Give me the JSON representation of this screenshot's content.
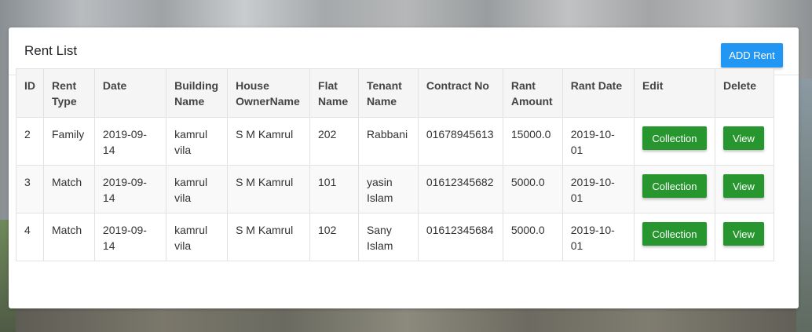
{
  "card": {
    "title": "Rent List",
    "add_button": "ADD Rent"
  },
  "table": {
    "headers": [
      "ID",
      "Rent Type",
      "Date",
      "Building Name",
      "House OwnerName",
      "Flat Name",
      "Tenant Name",
      "Contract No",
      "Rant Amount",
      "Rant Date",
      "Edit",
      "Delete"
    ],
    "rows": [
      {
        "id": "2",
        "rent_type": "Family",
        "date": "2019-09-14",
        "building": "kamrul vila",
        "owner": "S M Kamrul",
        "flat": "202",
        "tenant": "Rabbani",
        "contract": "01678945613",
        "amount": "15000.0",
        "rant_date": "2019-10-01",
        "edit_label": "Collection",
        "delete_label": "View"
      },
      {
        "id": "3",
        "rent_type": "Match",
        "date": "2019-09-14",
        "building": "kamrul vila",
        "owner": "S M Kamrul",
        "flat": "101",
        "tenant": "yasin Islam",
        "contract": "01612345682",
        "amount": "5000.0",
        "rant_date": "2019-10-01",
        "edit_label": "Collection",
        "delete_label": "View"
      },
      {
        "id": "4",
        "rent_type": "Match",
        "date": "2019-09-14",
        "building": "kamrul vila",
        "owner": "S M Kamrul",
        "flat": "102",
        "tenant": "Sany Islam",
        "contract": "01612345684",
        "amount": "5000.0",
        "rant_date": "2019-10-01",
        "edit_label": "Collection",
        "delete_label": "View"
      }
    ]
  }
}
